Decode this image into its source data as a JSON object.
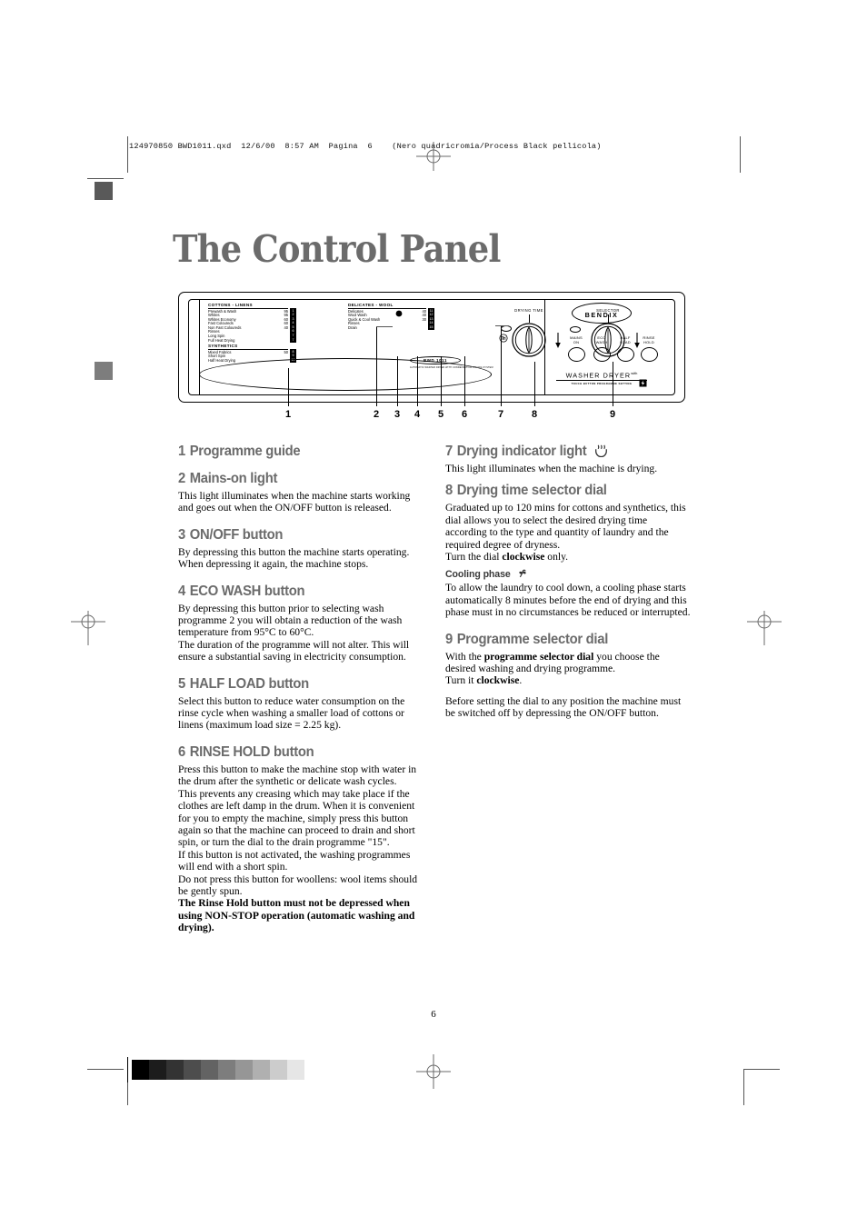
{
  "print_header": "124970850 BWD1011.qxd  12/6/00  8:57 AM  Pagina  6    (Nero quadricromia/Process Black pellicola)",
  "page_title": "The Control Panel",
  "folio": "6",
  "colors": {
    "heading_gray": "#6b6b6b",
    "subheading_gray": "#3a3a3a",
    "body_black": "#000000",
    "mark_gray": "#808080"
  },
  "panel": {
    "brand": "BENDIX",
    "model_badge": "BWD 1011",
    "model_sub": "AUTOMATIC WASHER DRYER WITH CONDENSATION DRYING SYSTEM",
    "washer_dryer_title": "WASHER DRYER",
    "washer_dryer_sup": "with",
    "washer_dryer_sub": "TOUCH BUTTON PROGRAMME SETTING",
    "programme_guide": {
      "groups": [
        {
          "title": "COTTONS - LINENS",
          "rows": [
            {
              "label": "Prewash & Wash",
              "temp": "95",
              "num": "1"
            },
            {
              "label": "Whites",
              "temp": "95",
              "num": "2"
            },
            {
              "label": "Whites Economy",
              "temp": "60",
              "num": "3"
            },
            {
              "label": "Fast Coloureds",
              "temp": "60",
              "num": "4"
            },
            {
              "label": "Non Fast Coloureds",
              "temp": "40",
              "num": "5"
            },
            {
              "label": "Rinses",
              "temp": "",
              "num": "6"
            },
            {
              "label": "Long Spin",
              "temp": "",
              "num": "7"
            },
            {
              "label": "Full Heat Drying",
              "temp": "",
              "num": "7"
            }
          ]
        },
        {
          "title": "SYNTHETICS",
          "rows": [
            {
              "label": "Mixed Fabrics",
              "temp": "50",
              "num": "8"
            },
            {
              "label": "Short Spin",
              "temp": "",
              "num": "9"
            },
            {
              "label": "Half Heat Drying",
              "temp": "",
              "num": "10"
            }
          ]
        },
        {
          "title": "DELICATES - WOOL",
          "rows": [
            {
              "label": "Delicates",
              "temp": "40",
              "num": "11"
            },
            {
              "label": "Wool Wash",
              "temp": "40",
              "num": "12"
            },
            {
              "label": "Quick & Cool Wash",
              "temp": "30",
              "num": "13"
            },
            {
              "label": "Rinses",
              "temp": "",
              "num": "14"
            },
            {
              "label": "Drain",
              "temp": "",
              "num": "15"
            }
          ]
        }
      ]
    },
    "buttons": [
      {
        "line1": "MAINS",
        "line2": "ON"
      },
      {
        "line1": "ECO",
        "line2": "WASH"
      },
      {
        "line1": "HALF",
        "line2": "LOAD"
      },
      {
        "line1": "RINSE",
        "line2": "HOLD"
      }
    ],
    "dials": [
      {
        "label": "DRYING TIME"
      },
      {
        "label": "SELECTOR"
      }
    ],
    "callouts": [
      "1",
      "2",
      "3",
      "4",
      "5",
      "6",
      "7",
      "8",
      "9"
    ]
  },
  "left_column": {
    "s1": {
      "num": "1",
      "title": "Programme guide"
    },
    "s2": {
      "num": "2",
      "title": "Mains-on light",
      "body": "This light illuminates when the machine starts working and goes out when the ON/OFF button is released."
    },
    "s3": {
      "num": "3",
      "title": "ON/OFF button",
      "body": "By depressing this button the machine starts operating. When depressing it again, the machine stops."
    },
    "s4": {
      "num": "4",
      "title": "ECO WASH button",
      "body1": "By depressing this button prior to selecting wash programme 2 you will obtain a reduction of the wash temperature from 95°C to 60°C.",
      "body2": "The duration of the programme will not alter. This will ensure a substantial saving in electricity consumption."
    },
    "s5": {
      "num": "5",
      "title": "HALF LOAD button",
      "body": "Select this button to reduce water consumption on the rinse cycle when washing a smaller load of cottons or linens  (maximum load size = 2.25 kg)."
    },
    "s6": {
      "num": "6",
      "title": "RINSE HOLD button",
      "body1": "Press this button to make the machine stop with water in the drum after the synthetic or delicate wash cycles.",
      "body2": "This prevents any creasing which may take place if the clothes are left damp in the drum. When it is convenient for you to empty the machine, simply press this button again so that the machine can proceed to drain and short spin, or turn the dial to the drain programme \"15\".",
      "body3": "If this button is not activated, the washing programmes will end with a short spin.",
      "body4": "Do not press this button for woollens: wool items should be gently spun.",
      "body5": "The Rinse Hold button must not be depressed when using NON-STOP operation (automatic washing and drying)."
    }
  },
  "right_column": {
    "s7": {
      "num": "7",
      "title": "Drying indicator light",
      "icon": "drying-heat-icon",
      "body": "This light illuminates when  the machine is drying."
    },
    "s8": {
      "num": "8",
      "title": "Drying time selector dial",
      "body1": "Graduated up to 120 mins for cottons and synthetics, this dial allows you to select the desired drying time according to the type and quantity of laundry and the required degree of dryness.",
      "body2_pre": "Turn the dial ",
      "body2_bold": "clockwise",
      "body2_post": " only.",
      "sub_title": "Cooling phase",
      "sub_icon": "fan-propeller-icon",
      "sub_body": "To allow the laundry to cool down, a cooling phase starts automatically 8 minutes before the end of drying and this phase must in no circumstances be reduced or interrupted."
    },
    "s9": {
      "num": "9",
      "title": "Programme selector dial",
      "body1_pre": "With the ",
      "body1_bold": "programme selector dial",
      "body1_post": " you choose the desired washing and drying programme.",
      "body2_pre": "Turn it ",
      "body2_bold": "clockwise",
      "body2_post": ".",
      "body3": "Before setting the dial to any position the machine must be switched off by depressing the ON/OFF button."
    }
  },
  "grey_scale_bar": [
    "#000000",
    "#1c1c1c",
    "#333333",
    "#4d4d4d",
    "#636363",
    "#7d7d7d",
    "#969696",
    "#b0b0b0",
    "#cccccc",
    "#e6e6e6"
  ]
}
